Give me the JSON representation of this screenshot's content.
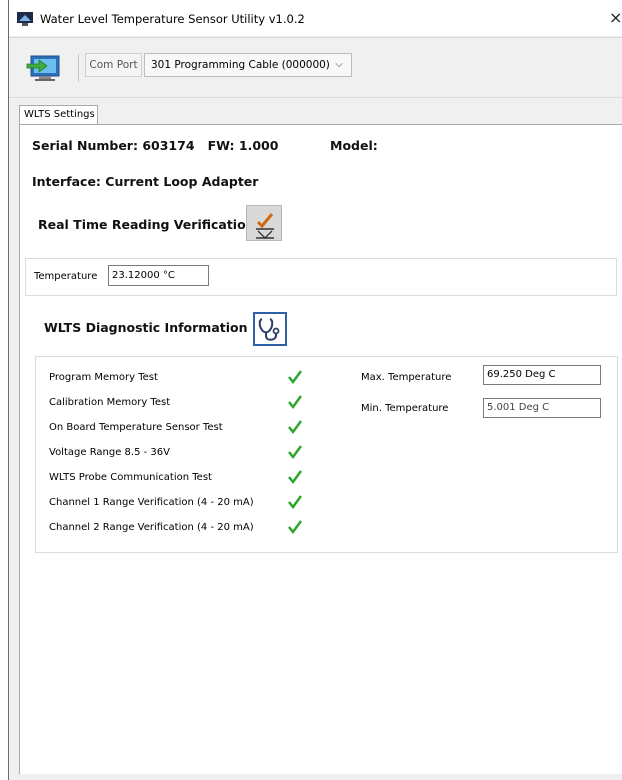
{
  "window": {
    "title": "Water Level Temperature Sensor Utility v1.0.2",
    "close_glyph": "×",
    "app_icon": "app-monitor-icon"
  },
  "toolbar": {
    "connect_icon": "connect-monitor-icon",
    "com_port_label": "Com Port",
    "com_port_value": "301 Programming Cable (000000)",
    "chevron": "⌵"
  },
  "tabs": [
    {
      "label": "WLTS Settings",
      "selected": true
    }
  ],
  "device": {
    "serial": "Serial Number: 603174",
    "fw": "FW: 1.000",
    "model": "Model:",
    "interface": "Interface: Current Loop Adapter"
  },
  "realtime": {
    "heading": "Real Time Reading Verification",
    "button_icon": "checklist-icon",
    "temperature_label": "Temperature",
    "temperature_value": "23.12000 °C"
  },
  "diagnostics": {
    "heading": "WLTS Diagnostic Information",
    "button_icon": "stethoscope-icon",
    "tests": [
      {
        "label": "Program Memory Test",
        "status": "pass"
      },
      {
        "label": "Calibration Memory Test",
        "status": "pass"
      },
      {
        "label": "On Board Temperature Sensor Test",
        "status": "pass"
      },
      {
        "label": "Voltage Range 8.5 - 36V",
        "status": "pass"
      },
      {
        "label": "WLTS Probe Communication Test",
        "status": "pass"
      },
      {
        "label": "Channel 1 Range Verification (4 - 20 mA)",
        "status": "pass"
      },
      {
        "label": "Channel 2 Range Verification (4 - 20 mA)",
        "status": "pass"
      }
    ],
    "max_temp_label": "Max. Temperature",
    "max_temp_value": "69.250 Deg C",
    "min_temp_label": "Min. Temperature",
    "min_temp_value": "5.001 Deg C"
  },
  "colors": {
    "check_green": "#2ea62e",
    "diag_border": "#2f5fa6"
  }
}
